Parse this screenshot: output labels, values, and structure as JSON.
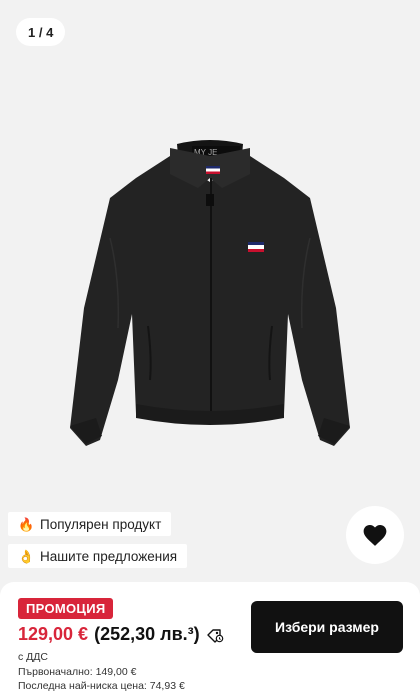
{
  "gallery": {
    "counter": "1 / 4"
  },
  "badges": [
    {
      "icon": "fire-icon",
      "label": "Популярен продукт"
    },
    {
      "icon": "ok-hand-icon",
      "label": "Нашите предложения"
    }
  ],
  "favorite": {
    "icon": "heart-icon"
  },
  "sheet": {
    "promo_label": "ПРОМОЦИЯ",
    "price": "129,00 €",
    "price_alt": "(252,30 лв.³)",
    "vat": "с ДДС",
    "original_price": "Първоначално: 149,00 €",
    "lowest_price": "Последна най-ниска цена: 74,93 €",
    "cta_label": "Избери размер"
  },
  "colors": {
    "promo": "#d8253a",
    "cta": "#111111",
    "background": "#f2f2f2"
  }
}
